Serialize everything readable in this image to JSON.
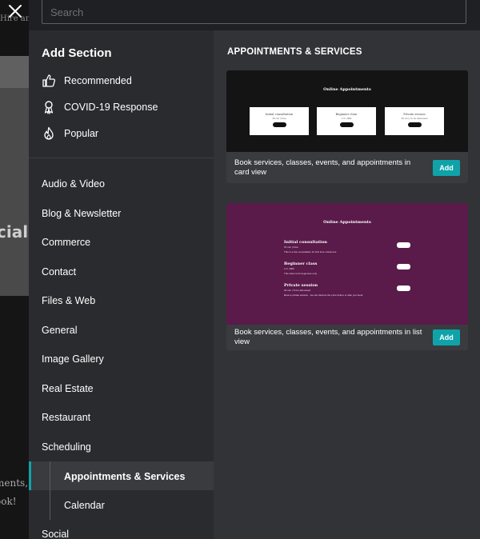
{
  "background": {
    "top_text": "Hire an",
    "heading": "cial",
    "line1": "ments,",
    "line2": "ook!"
  },
  "search": {
    "placeholder": "Search",
    "value": ""
  },
  "left_panel": {
    "title": "Add Section",
    "featured": [
      {
        "label": "Recommended",
        "icon": "thumbs-up-icon"
      },
      {
        "label": "COVID-19 Response",
        "icon": "ribbon-icon"
      },
      {
        "label": "Popular",
        "icon": "flame-icon"
      }
    ],
    "categories": [
      "Audio & Video",
      "Blog & Newsletter",
      "Commerce",
      "Contact",
      "Files & Web",
      "General",
      "Image Gallery",
      "Real Estate",
      "Restaurant",
      "Scheduling"
    ],
    "subcategories": [
      {
        "label": "Appointments & Services",
        "active": true
      },
      {
        "label": "Calendar",
        "active": false
      }
    ],
    "after": [
      "Social"
    ]
  },
  "right_panel": {
    "title": "APPOINTMENTS & SERVICES",
    "cards": [
      {
        "description": "Book services, classes, events, and appointments in card view",
        "add_label": "Add",
        "preview": {
          "bg": "#141414",
          "title": "Online Appointments",
          "items": [
            {
              "name": "Initial consultation",
              "meta": "15 min | Free"
            },
            {
              "name": "Beginner class",
              "meta": "1 hr | $50"
            },
            {
              "name": "Private session",
              "meta": "30 min | To be discussed"
            }
          ]
        }
      },
      {
        "description": "Book services, classes, events, and appointments in list view",
        "add_label": "Add",
        "preview": {
          "bg": "#5a1a4a",
          "title": "Online Appointments",
          "items": [
            {
              "name": "Initial consultation",
              "meta": "15 min | Free",
              "desc": "This is a free consultation for first time customers."
            },
            {
              "name": "Beginner class",
              "meta": "1 hr | $50",
              "desc": "This class is for beginners only."
            },
            {
              "name": "Private session",
              "meta": "30 min | To be discussed",
              "desc": "Book a private session - we can discuss the price before or after you book."
            }
          ]
        }
      }
    ]
  },
  "colors": {
    "accent": "#0fa3a9",
    "panel_left": "#2a2b2e",
    "panel_right": "#323337",
    "card": "#3a3b3f"
  }
}
